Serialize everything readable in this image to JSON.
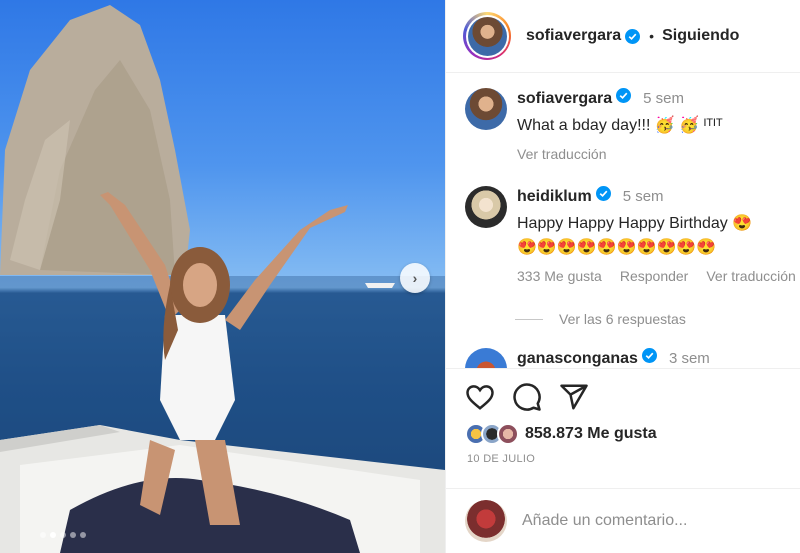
{
  "post": {
    "carousel": {
      "slide_count": 5,
      "active_slide": 2,
      "next_icon": "chevron-right-icon"
    }
  },
  "header": {
    "username": "sofiavergara",
    "verified": true,
    "separator": "•",
    "follow_status": "Siguiendo"
  },
  "comments": [
    {
      "username": "sofiavergara",
      "verified": true,
      "time": "5 sem",
      "text": "What a bday day!!! 🥳 🥳 ᴵᵀᴵᵀ",
      "translate": "Ver traducción"
    },
    {
      "username": "heidiklum",
      "verified": true,
      "time": "5 sem",
      "text_line1": "Happy Happy Happy Birthday 😍",
      "text_line2": "😍😍😍😍😍😍😍😍😍😍",
      "likes": "333 Me gusta",
      "reply": "Responder",
      "translate": "Ver traducción",
      "view_replies": "Ver las 6 respuestas"
    },
    {
      "username": "ganasconganas",
      "verified": true,
      "time": "3 sem"
    }
  ],
  "actions": {
    "like_icon": "heart-icon",
    "comment_icon": "comment-icon",
    "share_icon": "send-icon"
  },
  "likes": {
    "count_label": "858.873 Me gusta"
  },
  "date": "10 DE JULIO",
  "add_comment": {
    "placeholder": "Añade un comentario..."
  },
  "colors": {
    "verified": "#0095f6",
    "text": "#262626",
    "muted": "#8e8e8e"
  }
}
